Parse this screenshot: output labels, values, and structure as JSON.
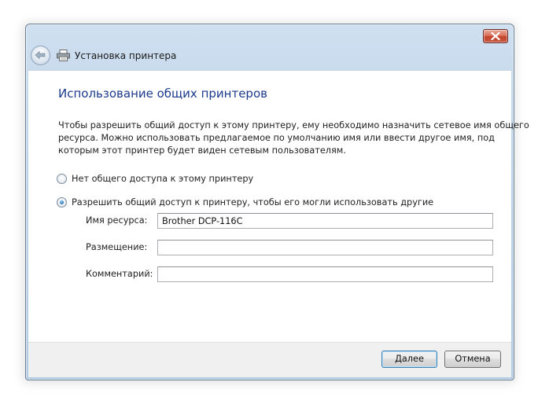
{
  "window": {
    "title": "Установка принтера",
    "title_icon": "printer-icon",
    "back_icon": "back-arrow-icon",
    "close_icon": "close-icon"
  },
  "page": {
    "heading": "Использование общих принтеров",
    "description_lines": [
      "Чтобы разрешить общий доступ к этому принтеру, ему необходимо назначить сетевое имя общего",
      "ресурса. Можно использовать предлагаемое по умолчанию имя или ввести другое имя, под",
      "которым этот принтер будет виден сетевым пользователям."
    ]
  },
  "sharing": {
    "option_no_share": "Нет общего доступа к этому принтеру",
    "option_share": "Разрешить общий доступ к принтеру, чтобы его могли использовать другие",
    "selected": "share"
  },
  "fields": {
    "share_name_label": "Имя ресурса:",
    "share_name_value": "Brother DCP-116C",
    "location_label": "Размещение:",
    "location_value": "",
    "comment_label": "Комментарий:",
    "comment_value": ""
  },
  "footer": {
    "next_label": "Далее",
    "cancel_label": "Отмена"
  }
}
